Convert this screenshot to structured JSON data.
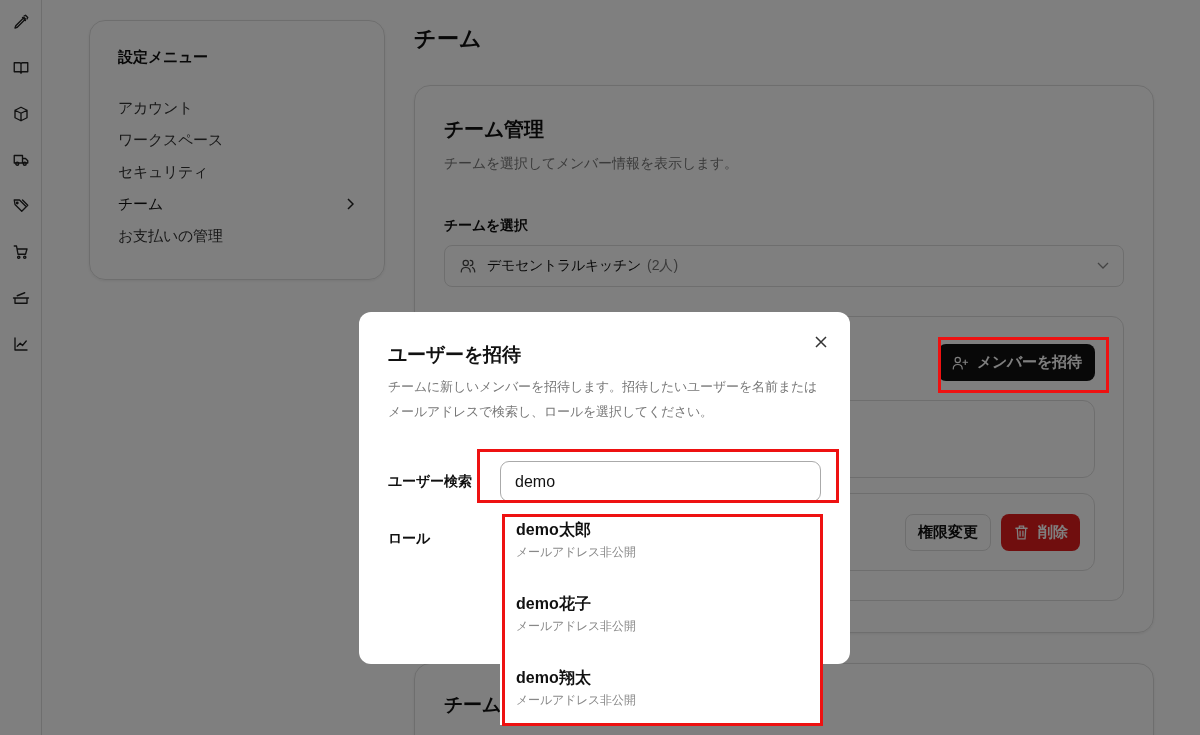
{
  "settings_menu": {
    "title": "設定メニュー",
    "items": [
      {
        "label": "アカウント",
        "selected": false
      },
      {
        "label": "ワークスペース",
        "selected": false
      },
      {
        "label": "セキュリティ",
        "selected": false
      },
      {
        "label": "チーム",
        "selected": true
      },
      {
        "label": "お支払いの管理",
        "selected": false
      }
    ]
  },
  "page_title": "チーム",
  "team_card": {
    "title": "チーム管理",
    "description": "チームを選択してメンバー情報を表示します。",
    "select_label": "チームを選択",
    "select": {
      "value": "デモセントラルキッチン",
      "count": "(2人)"
    },
    "invite_button": {
      "label": "メンバーを招待",
      "highlighted": true
    },
    "member_actions": {
      "role_button": "権限変更",
      "delete_button": "削除"
    }
  },
  "next_card": {
    "title": "チーム"
  },
  "dialog": {
    "title": "ユーザーを招待",
    "description": "チームに新しいメンバーを招待します。招待したいユーザーを名前またはメールアドレスで検索し、ロールを選択してください。",
    "search_label": "ユーザー検索",
    "search": {
      "value": "demo",
      "highlighted": true
    },
    "role_label": "ロール",
    "suggestions": {
      "highlighted": true,
      "items": [
        {
          "name": "demo太郎",
          "note": "メールアドレス非公開"
        },
        {
          "name": "demo花子",
          "note": "メールアドレス非公開"
        },
        {
          "name": "demo翔太",
          "note": "メールアドレス非公開"
        }
      ]
    }
  }
}
